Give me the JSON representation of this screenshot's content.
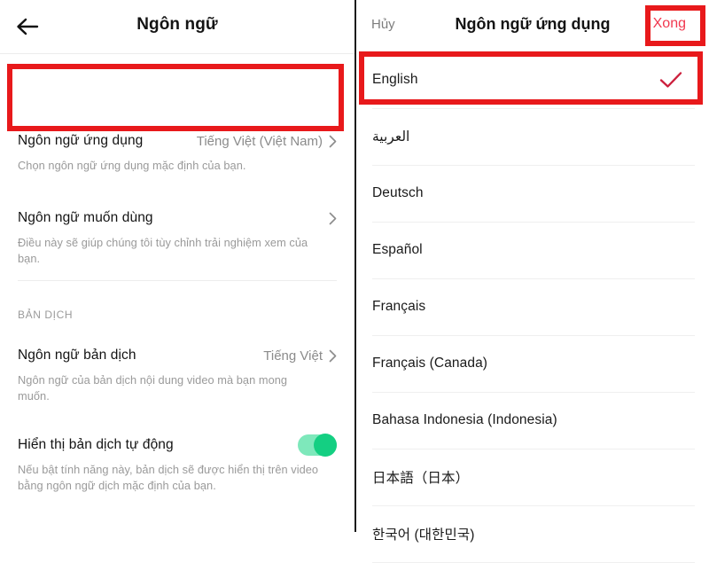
{
  "left_panel": {
    "header": {
      "back_icon": "arrow-left-icon",
      "title": "Ngôn ngữ"
    },
    "rows": [
      {
        "label": "Ngôn ngữ ứng dụng",
        "value": "Tiếng Việt (Việt Nam)",
        "sub": "Chọn ngôn ngữ ứng dụng mặc định của bạn.",
        "chevron": "chevron-right-icon"
      },
      {
        "label": "Ngôn ngữ muốn dùng",
        "value": "",
        "sub": "Điều này sẽ giúp chúng tôi tùy chỉnh trải nghiệm xem của bạn.",
        "chevron": "chevron-right-icon"
      }
    ],
    "section_heading": "BẢN DỊCH",
    "translate_rows": [
      {
        "label": "Ngôn ngữ bản dịch",
        "value": "Tiếng Việt",
        "sub": "Ngôn ngữ của bản dịch nội dung video mà bạn mong muốn.",
        "chevron": "chevron-right-icon"
      },
      {
        "label": "Hiển thị bản dịch tự động",
        "sub": "Nếu bật tính năng này, bản dịch sẽ được hiển thị trên video bằng ngôn ngữ dịch mặc định của bạn.",
        "toggle_on": true,
        "toggle_color": "#14cf82"
      }
    ]
  },
  "right_panel": {
    "header": {
      "cancel_label": "Hủy",
      "title": "Ngôn ngữ ứng dụng",
      "done_label": "Xong",
      "done_color": "#f1384f"
    },
    "languages": [
      {
        "label": "English",
        "selected": true,
        "rtl": false
      },
      {
        "label": "العربية",
        "selected": false,
        "rtl": true
      },
      {
        "label": "Deutsch",
        "selected": false,
        "rtl": false
      },
      {
        "label": "Español",
        "selected": false,
        "rtl": false
      },
      {
        "label": "Français",
        "selected": false,
        "rtl": false
      },
      {
        "label": "Français (Canada)",
        "selected": false,
        "rtl": false
      },
      {
        "label": "Bahasa Indonesia (Indonesia)",
        "selected": false,
        "rtl": false
      },
      {
        "label": "日本語（日本）",
        "selected": false,
        "rtl": false
      },
      {
        "label": "한국어 (대한민국)",
        "selected": false,
        "rtl": false
      }
    ],
    "check_icon": "check-icon",
    "check_color": "#cc1f3c"
  },
  "annotations": {
    "color": "#e8191b",
    "boxes": [
      {
        "name": "app-language-row-highlight"
      },
      {
        "name": "english-option-highlight"
      },
      {
        "name": "done-button-highlight"
      }
    ]
  }
}
